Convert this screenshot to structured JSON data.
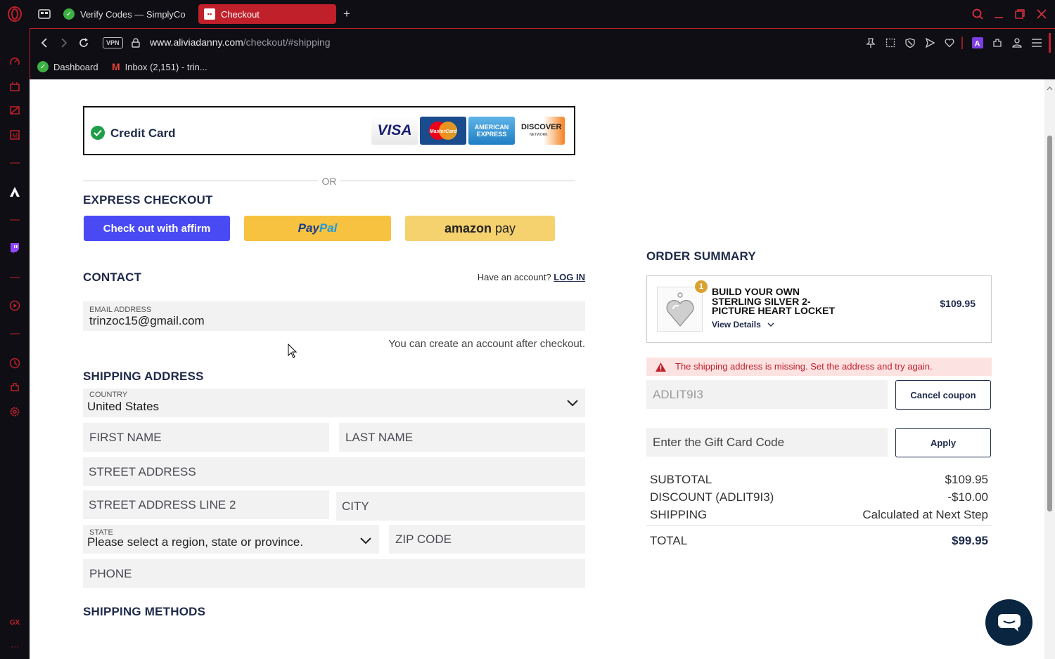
{
  "browser": {
    "tabs": [
      {
        "label": "Verify Codes — SimplyCo",
        "active": false
      },
      {
        "label": "Checkout",
        "active": true
      }
    ],
    "new_tab": "+",
    "vpn": "VPN",
    "url_domain": "www.aliviadanny.com",
    "url_path": "/checkout/#shipping",
    "bookmarks": [
      "Dashboard",
      "Inbox (2,151) - trin..."
    ],
    "sidebar_bottom": "GX",
    "sidebar_more": "···"
  },
  "payment": {
    "credit_card_label": "Credit Card",
    "cards": [
      "VISA",
      "MasterCard",
      "AMERICAN EXPRESS",
      "DISCOVER"
    ],
    "discover_sub": "NETWORK",
    "or_label": "OR"
  },
  "express": {
    "title": "EXPRESS CHECKOUT",
    "affirm": "Check out with affirm",
    "paypal_a": "Pay",
    "paypal_b": "Pal",
    "amazon_a": "amazon",
    "amazon_b": "pay"
  },
  "contact": {
    "title": "CONTACT",
    "have_account": "Have an account?",
    "login": "LOG IN",
    "email_label": "EMAIL ADDRESS",
    "email_value": "trinzoc15@gmail.com",
    "create_note": "You can create an account after checkout."
  },
  "shipping": {
    "title": "SHIPPING ADDRESS",
    "country_label": "COUNTRY",
    "country_value": "United States",
    "first_name": "FIRST NAME",
    "last_name": "LAST NAME",
    "street": "STREET ADDRESS",
    "street2": "STREET ADDRESS LINE 2",
    "city": "CITY",
    "state_label": "STATE",
    "state_value": "Please select a region, state or province.",
    "zip": "ZIP CODE",
    "phone": "PHONE",
    "methods_title": "SHIPPING METHODS"
  },
  "summary": {
    "title": "ORDER SUMMARY",
    "item_qty": "1",
    "item_name_1": "BUILD YOUR OWN",
    "item_name_2": "STERLING SILVER 2-",
    "item_name_3": "PICTURE HEART LOCKET",
    "item_price": "$109.95",
    "view_details": "View Details",
    "error": "The shipping address is missing. Set the address and try again.",
    "coupon_value": "ADLIT9I3",
    "cancel_coupon": "Cancel coupon",
    "gift_placeholder": "Enter the Gift Card Code",
    "apply": "Apply",
    "subtotal_label": "SUBTOTAL",
    "subtotal_value": "$109.95",
    "discount_label": "DISCOUNT (ADLIT9I3)",
    "discount_value": "-$10.00",
    "shipping_label": "SHIPPING",
    "shipping_value": "Calculated at Next Step",
    "total_label": "TOTAL",
    "total_value": "$99.95"
  },
  "colors": {
    "accent_red": "#c0202a",
    "navy": "#1e2a4a",
    "affirm": "#4a4af4",
    "paypal": "#f7c240",
    "amazon": "#f5d26e",
    "chat": "#0a2540"
  }
}
